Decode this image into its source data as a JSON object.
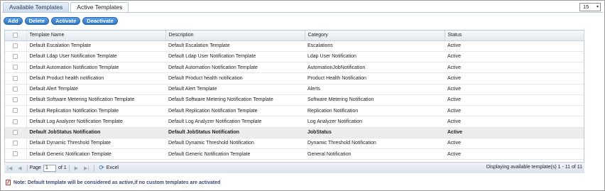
{
  "tabs": [
    {
      "label": "Available Templates",
      "active": false
    },
    {
      "label": "Active Templates",
      "active": true
    }
  ],
  "page_size": {
    "value": "15"
  },
  "toolbar": {
    "add": "Add",
    "delete": "Delete",
    "activate": "Activate",
    "deactivate": "Deactivate"
  },
  "table": {
    "headers": [
      "Template Name",
      "Description",
      "Category",
      "Status"
    ],
    "rows": [
      [
        "Default Escalation Template",
        "Default Escalation Template",
        "Escalations",
        "Active"
      ],
      [
        "Default Ldap User Notification Template",
        "Default Ldap User Notification Template",
        "Ldap User Notification",
        "Active"
      ],
      [
        "Default Automation Notification Template",
        "Default Automation Notification Template",
        "AutomationJobNotification",
        "Active"
      ],
      [
        "Default Product health notification",
        "Default Product health notification",
        "Product Health Notification",
        "Active"
      ],
      [
        "Default Alert Template",
        "Default Alert Template",
        "Alerts",
        "Active"
      ],
      [
        "Default Software Metering Notification Template",
        "Default Software Metering Notification Template",
        "Software Metering Notification",
        "Active"
      ],
      [
        "Default Replication Notification Template",
        "Default Replication Notification Template",
        "Replication Notification",
        "Active"
      ],
      [
        "Default Log Analyzer Notification Template",
        "Default Log Analyzer Notification Template",
        "Log Analyzer Notification",
        "Active"
      ],
      [
        "Default JobStatus Notification",
        "Default JobStatus Notification",
        "JobStatus",
        "Active"
      ],
      [
        "Default Dynamic Threshold Template",
        "Default Dynamic Threshold Notification",
        "Dynamic Threshold Notification",
        "Active"
      ],
      [
        "Default Generic Notification Template",
        "Default Generic Notification Template",
        "General Notification",
        "Active"
      ]
    ],
    "selected_row": 8
  },
  "pager": {
    "page_label": "Page",
    "page_value": "1",
    "of_label": "of 1",
    "excel_label": "Excel",
    "summary": "Displaying available template(s) 1 - 11 of 11"
  },
  "note": "Note: Default template will be considered as active,if no custom templates are activated"
}
